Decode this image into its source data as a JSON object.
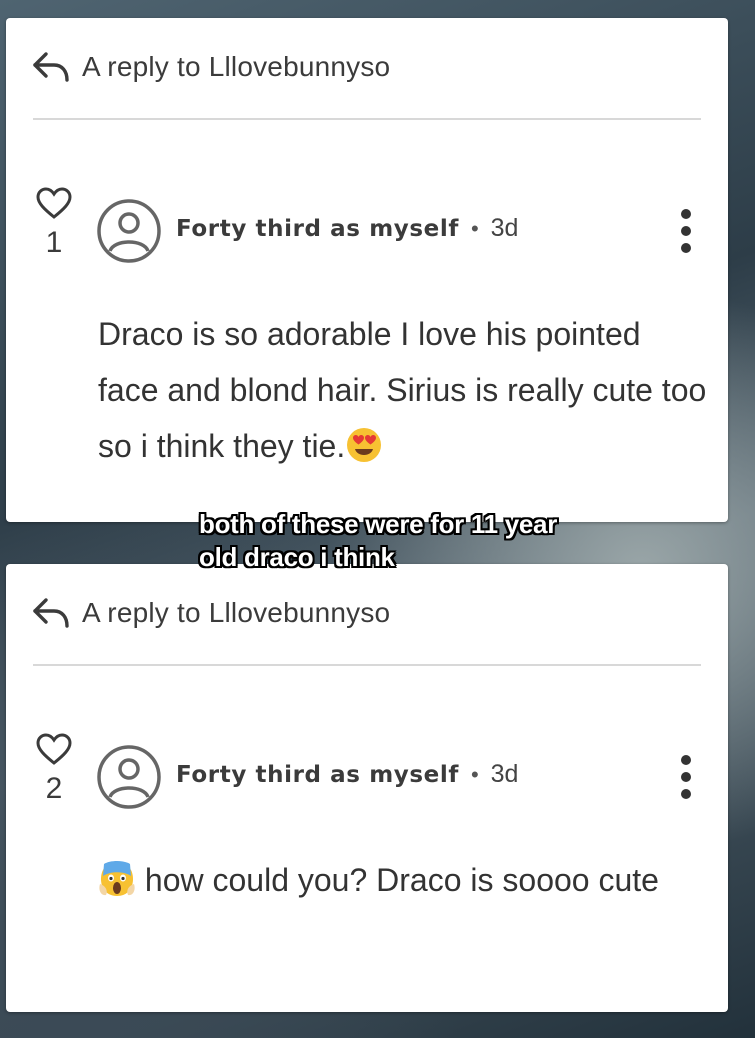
{
  "overlay_caption": "both of these were for 11 year old draco i think",
  "comments": [
    {
      "reply_to": "A reply to Lllovebunnyso",
      "likes": "1",
      "author": "Forty third as myself",
      "separator": "•",
      "time": "3d",
      "text": "Draco is so adorable I love his pointed face and blond hair. Sirius is really cute too so i think they tie.",
      "emoji": "heart-eyes-emoji"
    },
    {
      "reply_to": "A reply to Lllovebunnyso",
      "likes": "2",
      "author": "Forty third as myself",
      "separator": "•",
      "time": "3d",
      "text": "how could you? Draco is soooo cute",
      "emoji": "screaming-face-emoji"
    }
  ],
  "colors": {
    "card_bg": "#ffffff",
    "text": "#333333",
    "divider": "#d8d8d8",
    "icon": "#3b3b3b",
    "caption": "#ffffff"
  }
}
